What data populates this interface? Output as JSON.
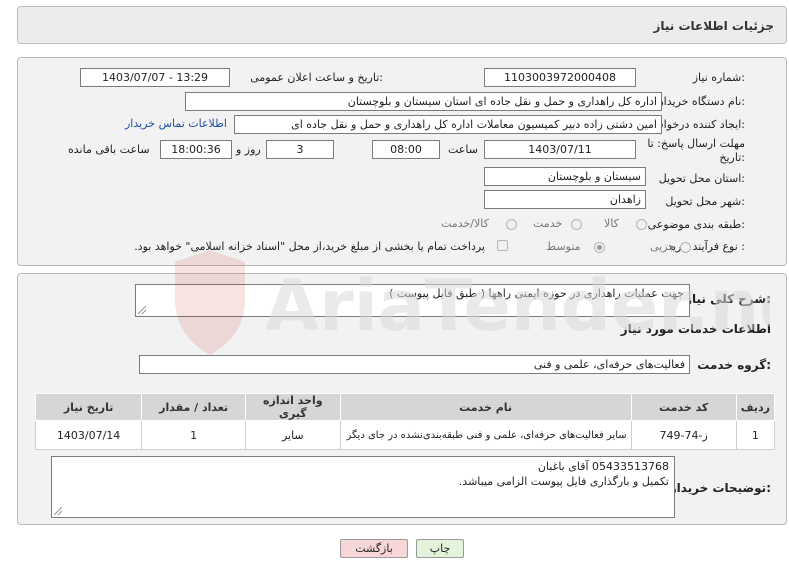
{
  "header": {
    "title": "جزئیات اطلاعات نیاز"
  },
  "fields": {
    "need_number_label": "شماره نیاز:",
    "need_number": "1103003972000408",
    "announce_label": "تاریخ و ساعت اعلان عمومی:",
    "announce_value": "1403/07/07 - 13:29",
    "buyer_org_label": "نام دستگاه خریدار:",
    "buyer_org": "اداره کل راهداری و حمل و نقل جاده ای استان سیستان و بلوچستان",
    "creator_label": "ایجاد کننده درخواست:",
    "creator": "امین دشتی زاده دبیر کمیسیون معاملات اداره کل راهداری و حمل و نقل جاده ای",
    "contact_link": "اطلاعات تماس خریدار",
    "deadline_label": "مهلت ارسال پاسخ: تا",
    "deadline_label2": "تاریخ:",
    "deadline_date": "1403/07/11",
    "time_label": "ساعت",
    "deadline_time": "08:00",
    "days_value": "3",
    "days_label": "روز و",
    "remaining_value": "18:00:36",
    "remaining_label": "ساعت باقی مانده",
    "province_label": "استان محل تحویل:",
    "province": "سیستان و بلوچستان",
    "city_label": "شهر محل تحویل:",
    "city": "زاهدان",
    "category_label": "طبقه بندی موضوعی:",
    "category_options": [
      "کالا",
      "خدمت",
      "کالا/خدمت"
    ],
    "process_label": "نوع فرآیند خرید :",
    "process_options": [
      "جزیی",
      "متوسط"
    ],
    "payment_note": "پرداخت تمام یا بخشی از مبلغ خرید،از محل \"اسناد خزانه اسلامی\" خواهد بود."
  },
  "summary": {
    "label": "شرح کلی نیاز:",
    "text": "جهت عملیات راهداری در حوزه ایمنی راهها ( طبق فایل پیوست )"
  },
  "services": {
    "section_title": "اطلاعات خدمات مورد نیاز",
    "group_label": "گروه خدمت:",
    "group_value": "فعالیت‌های حرفه‌ای، علمی و فنی",
    "columns": [
      "ردیف",
      "کد خدمت",
      "نام خدمت",
      "واحد اندازه گیری",
      "تعداد / مقدار",
      "تاریخ نیاز"
    ],
    "rows": [
      {
        "row": "1",
        "code": "ز-74-749",
        "name": "سایر فعالیت‌های حرفه‌ای، علمی و فنی طبقه‌بندی‌نشده در جای دیگر",
        "unit": "سایر",
        "qty": "1",
        "date": "1403/07/14"
      }
    ]
  },
  "buyer_notes": {
    "label": "توضیحات خریدار:",
    "text": "05433513768 آقای باغبان\nتکمیل و بارگذاری فایل پیوست الزامی میباشد."
  },
  "actions": {
    "print": "چاپ",
    "back": "بازگشت"
  },
  "watermark": {
    "text": "AriaTender.neT"
  },
  "colors": {
    "link": "#1d4fa7",
    "back_button_bg": "#f6d6d6",
    "print_button_bg": "#e4f4dc"
  }
}
